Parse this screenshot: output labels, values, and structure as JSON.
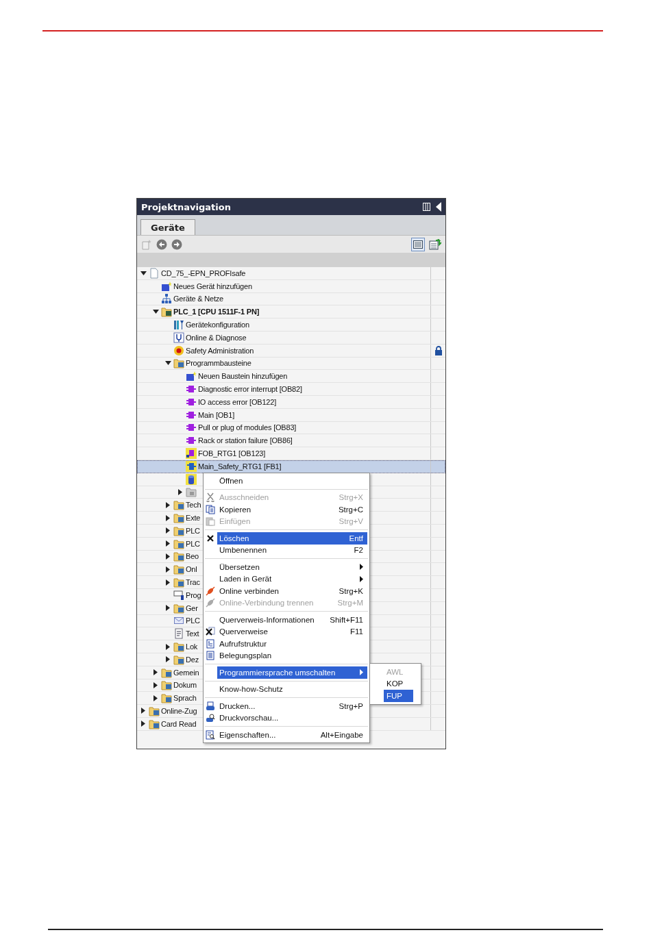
{
  "panel": {
    "title": "Projektnavigation"
  },
  "tabs": [
    {
      "label": "Geräte",
      "selected": true
    }
  ],
  "toolbar": {
    "view_selected": true
  },
  "tree": [
    {
      "label": "CD_75_-EPN_PROFIsafe",
      "kind": "project",
      "expanded": true,
      "selected": false,
      "children": [
        {
          "label": "Neues Gerät hinzufügen",
          "kind": "add-device",
          "selected": false
        },
        {
          "label": "Geräte & Netze",
          "kind": "network",
          "selected": false
        },
        {
          "label": "PLC_1 [CPU 1511F-1 PN]",
          "kind": "plc",
          "expanded": true,
          "selected": false,
          "children": [
            {
              "label": "Gerätekonfiguration",
              "kind": "config",
              "selected": false
            },
            {
              "label": "Online & Diagnose",
              "kind": "diagnose",
              "selected": false
            },
            {
              "label": "Safety Administration",
              "kind": "safety",
              "selected": false,
              "locked": true
            },
            {
              "label": "Programmbausteine",
              "kind": "folder",
              "expanded": true,
              "selected": false,
              "children": [
                {
                  "label": "Neuen Baustein hinzufügen",
                  "kind": "add-block",
                  "selected": false
                },
                {
                  "label": "Diagnostic error interrupt [OB82]",
                  "kind": "ob",
                  "selected": false
                },
                {
                  "label": "IO access error [OB122]",
                  "kind": "ob",
                  "selected": false
                },
                {
                  "label": "Main [OB1]",
                  "kind": "ob",
                  "selected": false
                },
                {
                  "label": "Pull or plug of modules [OB83]",
                  "kind": "ob",
                  "selected": false
                },
                {
                  "label": "Rack or station failure [OB86]",
                  "kind": "ob",
                  "selected": false
                },
                {
                  "label": "FOB_RTG1 [OB123]",
                  "kind": "fob",
                  "selected": false
                },
                {
                  "label": "Main_Safety_RTG1 [FB1]",
                  "kind": "fb",
                  "selected": true
                },
                {
                  "kind": "db",
                  "selected": false
                },
                {
                  "kind": "group",
                  "expanded": false,
                  "selected": false
                }
              ]
            },
            {
              "label": "Tech",
              "kind": "folder",
              "expanded": false,
              "selected": false
            },
            {
              "label": "Exte",
              "kind": "folder",
              "expanded": false,
              "selected": false
            },
            {
              "label": "PLC",
              "kind": "folder",
              "expanded": false,
              "selected": false
            },
            {
              "label": "PLC",
              "kind": "folder",
              "expanded": false,
              "selected": false
            },
            {
              "label": "Beo",
              "kind": "folder",
              "expanded": false,
              "selected": false
            },
            {
              "label": "Onl",
              "kind": "folder",
              "expanded": false,
              "selected": false
            },
            {
              "label": "Trac",
              "kind": "folder",
              "expanded": false,
              "selected": false
            },
            {
              "label": "Prog",
              "kind": "info",
              "selected": false
            },
            {
              "label": "Ger",
              "kind": "folder",
              "expanded": false,
              "selected": false
            },
            {
              "label": "PLC",
              "kind": "mail",
              "selected": false
            },
            {
              "label": "Text",
              "kind": "text",
              "selected": false
            },
            {
              "label": "Lok",
              "kind": "folder",
              "expanded": false,
              "selected": false
            },
            {
              "label": "Dez",
              "kind": "folder",
              "expanded": false,
              "selected": false
            }
          ]
        },
        {
          "label": "Gemein",
          "kind": "folder",
          "expanded": false,
          "selected": false
        },
        {
          "label": "Dokum",
          "kind": "folder",
          "expanded": false,
          "selected": false
        },
        {
          "label": "Sprach",
          "kind": "folder",
          "expanded": false,
          "selected": false
        }
      ]
    },
    {
      "label": "Online-Zug",
      "kind": "folder",
      "expanded": false,
      "selected": false
    },
    {
      "label": "Card Read",
      "kind": "folder",
      "expanded": false,
      "selected": false
    }
  ],
  "context_menu": [
    [
      {
        "label": "Öffnen",
        "disabled": false,
        "selected": false
      }
    ],
    [
      {
        "label": "Ausschneiden",
        "shortcut": "Strg+X",
        "disabled": true,
        "selected": false
      },
      {
        "label": "Kopieren",
        "shortcut": "Strg+C",
        "disabled": false,
        "selected": false
      },
      {
        "label": "Einfügen",
        "shortcut": "Strg+V",
        "disabled": true,
        "selected": false
      }
    ],
    [
      {
        "label": "Löschen",
        "shortcut": "Entf",
        "disabled": false,
        "selected": true
      },
      {
        "label": "Umbenennen",
        "shortcut": "F2",
        "disabled": false,
        "selected": false
      }
    ],
    [
      {
        "label": "Übersetzen",
        "has_submenu": true,
        "disabled": false,
        "selected": false
      },
      {
        "label": "Laden in Gerät",
        "has_submenu": true,
        "disabled": false,
        "selected": false
      },
      {
        "label": "Online verbinden",
        "shortcut": "Strg+K",
        "disabled": false,
        "selected": false
      },
      {
        "label": "Online-Verbindung trennen",
        "shortcut": "Strg+M",
        "disabled": true,
        "selected": false
      }
    ],
    [
      {
        "label": "Querverweis-Informationen",
        "shortcut": "Shift+F11",
        "disabled": false,
        "selected": false
      },
      {
        "label": "Querverweise",
        "shortcut": "F11",
        "disabled": false,
        "selected": false
      },
      {
        "label": "Aufrufstruktur",
        "disabled": false,
        "selected": false
      },
      {
        "label": "Belegungsplan",
        "disabled": false,
        "selected": false
      }
    ],
    [
      {
        "label": "Programmiersprache umschalten",
        "has_submenu": true,
        "disabled": false,
        "selected": true
      }
    ],
    [
      {
        "label": "Know-how-Schutz",
        "disabled": false,
        "selected": false
      }
    ],
    [
      {
        "label": "Drucken...",
        "shortcut": "Strg+P",
        "disabled": false,
        "selected": false
      },
      {
        "label": "Druckvorschau...",
        "disabled": false,
        "selected": false
      }
    ],
    [
      {
        "label": "Eigenschaften...",
        "shortcut": "Alt+Eingabe",
        "disabled": false,
        "selected": false
      }
    ]
  ],
  "submenu": [
    {
      "label": "AWL",
      "disabled": true,
      "selected": false
    },
    {
      "label": "KOP",
      "disabled": false,
      "selected": false
    },
    {
      "label": "FUP",
      "disabled": false,
      "selected": true
    }
  ]
}
